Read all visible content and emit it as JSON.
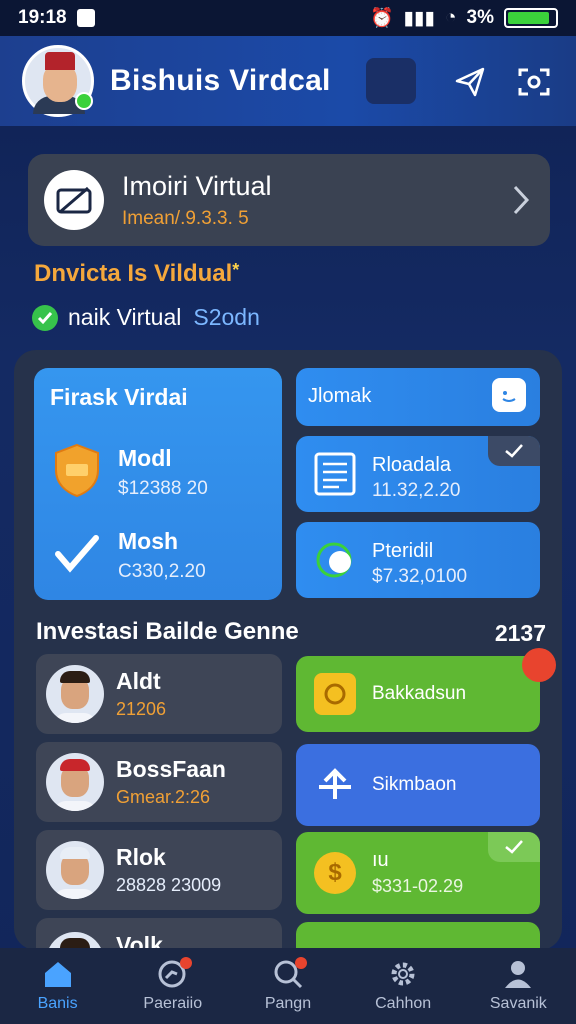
{
  "status_bar": {
    "time": "19:18",
    "battery_text": "3%"
  },
  "header": {
    "title": "Bishuis Virdcal"
  },
  "account_card": {
    "title": "Imoiri Virtual",
    "subtitle": "Imean/.9.3.3. 5"
  },
  "promo": {
    "text": "Dnvicta Is Vildual",
    "star": "*"
  },
  "verify": {
    "label": "naik Virtual",
    "value": "S2odn"
  },
  "big_tile": {
    "title": "Firask Virdai",
    "rows": [
      {
        "label": "Modl",
        "value": "$12388 20"
      },
      {
        "label": "Mosh",
        "value": "C330,2.20"
      }
    ]
  },
  "side_tiles": [
    {
      "label": "Jlomak"
    },
    {
      "label": "Rloadala",
      "value": "11.32,2.20"
    },
    {
      "label": "Pteridil",
      "value": "$7.32,0100"
    }
  ],
  "section": {
    "title": "Investasi Bailde Genne",
    "count": "2137"
  },
  "people": [
    {
      "name": "Aldt",
      "amount": "21206"
    },
    {
      "name": "BossFaan",
      "amount": "Gmear.2:26"
    },
    {
      "name": "Rlok",
      "amount": "28828 23009"
    },
    {
      "name": "Volk"
    }
  ],
  "actions": [
    {
      "label": "Bakkadsun",
      "color": "#5fb833"
    },
    {
      "label": "Sikmbaon",
      "color": "#3b6fe0"
    },
    {
      "label": "ıu",
      "sub": "$331-02.29",
      "color": "#5fb833"
    },
    {
      "label": "",
      "color": "#5fb833"
    }
  ],
  "bottom_nav": [
    {
      "label": "Banis",
      "icon": "home-icon",
      "active": true
    },
    {
      "label": "Paeraiio",
      "icon": "chart-icon"
    },
    {
      "label": "Pangn",
      "icon": "search-icon"
    },
    {
      "label": "Cahhon",
      "icon": "gear-icon"
    },
    {
      "label": "Savanik",
      "icon": "profile-icon"
    }
  ]
}
